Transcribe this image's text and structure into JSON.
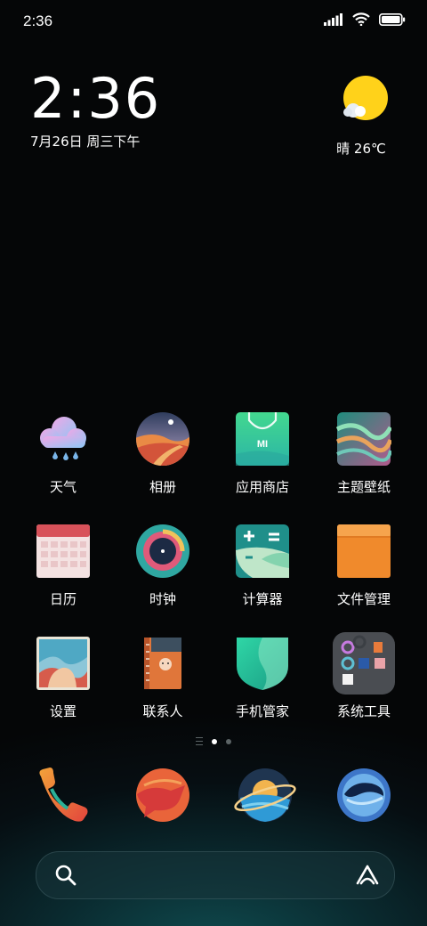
{
  "status_bar": {
    "time": "2:36",
    "icons": [
      "signal-icon",
      "wifi-icon",
      "battery-icon"
    ]
  },
  "clock_widget": {
    "time": "2:36",
    "date": "7月26日 周三下午"
  },
  "weather_widget": {
    "condition": "晴",
    "temperature": "26℃",
    "icon": "sun-icon",
    "display": "晴 26℃"
  },
  "apps": [
    {
      "name": "天气",
      "icon": "weather-app-icon"
    },
    {
      "name": "相册",
      "icon": "gallery-app-icon"
    },
    {
      "name": "应用商店",
      "icon": "app-store-icon"
    },
    {
      "name": "主题壁纸",
      "icon": "themes-icon"
    },
    {
      "name": "日历",
      "icon": "calendar-icon"
    },
    {
      "name": "时钟",
      "icon": "clock-icon"
    },
    {
      "name": "计算器",
      "icon": "calculator-icon"
    },
    {
      "name": "文件管理",
      "icon": "file-manager-icon"
    },
    {
      "name": "设置",
      "icon": "settings-icon"
    },
    {
      "name": "联系人",
      "icon": "contacts-icon"
    },
    {
      "name": "手机管家",
      "icon": "security-icon"
    },
    {
      "name": "系统工具",
      "icon": "folder-icon"
    }
  ],
  "page_indicator": {
    "pages": 2,
    "current": 1
  },
  "dock": [
    "phone-icon",
    "messages-icon",
    "browser-icon",
    "camera-icon"
  ],
  "search_bar": {
    "left_icon": "search-icon",
    "right_icon": "assistant-icon"
  }
}
